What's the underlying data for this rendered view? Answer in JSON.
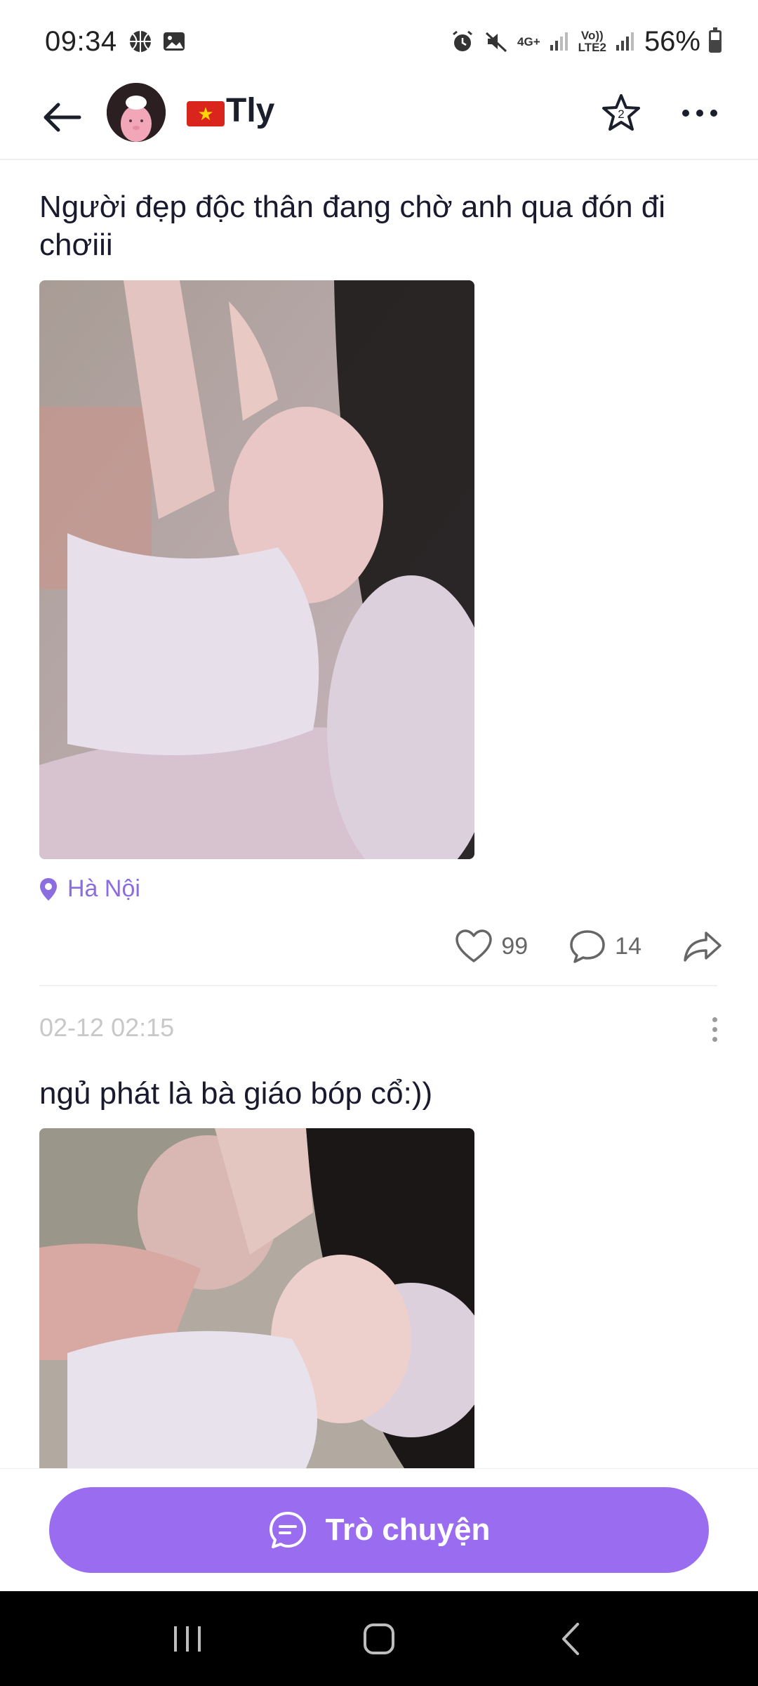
{
  "status_bar": {
    "time": "09:34",
    "network_top": "Vo))",
    "network_bottom": "LTE2",
    "net_4g": "4G+",
    "battery_percent": "56%",
    "battery_level": 0.56
  },
  "header": {
    "user_name": "Tly",
    "flag": "🇻🇳",
    "star_badge": "2"
  },
  "posts": [
    {
      "text": "Người đẹp độc thân đang chờ anh qua đón đi chơiii",
      "location": "Hà Nội",
      "likes": "99",
      "comments": "14"
    },
    {
      "timestamp": "02-12 02:15",
      "text": "ngủ phát là bà giáo bóp cổ:))"
    }
  ],
  "chat": {
    "label": "Trò chuyện"
  },
  "colors": {
    "accent": "#9a6df0",
    "location": "#8c6de0"
  },
  "icons": {
    "back": "arrow-left-icon",
    "star": "star-icon",
    "more": "more-horizontal-icon",
    "location": "location-pin-icon",
    "like": "heart-icon",
    "comment": "comment-icon",
    "share": "share-icon",
    "chat": "chat-bubble-icon"
  }
}
